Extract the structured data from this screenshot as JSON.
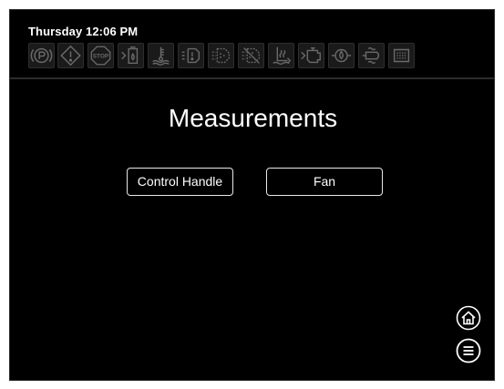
{
  "header": {
    "datetime": "Thursday 12:06 PM"
  },
  "telltales": [
    {
      "name": "parking-brake-icon"
    },
    {
      "name": "warning-icon"
    },
    {
      "name": "stop-icon",
      "label": "STOP"
    },
    {
      "name": "fuel-water-icon"
    },
    {
      "name": "coolant-temp-icon"
    },
    {
      "name": "def-fluid-icon"
    },
    {
      "name": "dpf-regen-icon"
    },
    {
      "name": "regen-inhibit-icon"
    },
    {
      "name": "hest-icon"
    },
    {
      "name": "engine-icon"
    },
    {
      "name": "oil-pressure-icon"
    },
    {
      "name": "glow-plug-icon"
    },
    {
      "name": "air-filter-icon"
    }
  ],
  "main": {
    "title": "Measurements",
    "buttons": [
      {
        "label": "Control Handle"
      },
      {
        "label": "Fan"
      }
    ]
  },
  "colors": {
    "background": "#000000",
    "text": "#ffffff",
    "icon": "#6a6a6a",
    "button_border": "#e8e8e8"
  },
  "nav": {
    "home": "home-icon",
    "menu": "menu-icon"
  }
}
